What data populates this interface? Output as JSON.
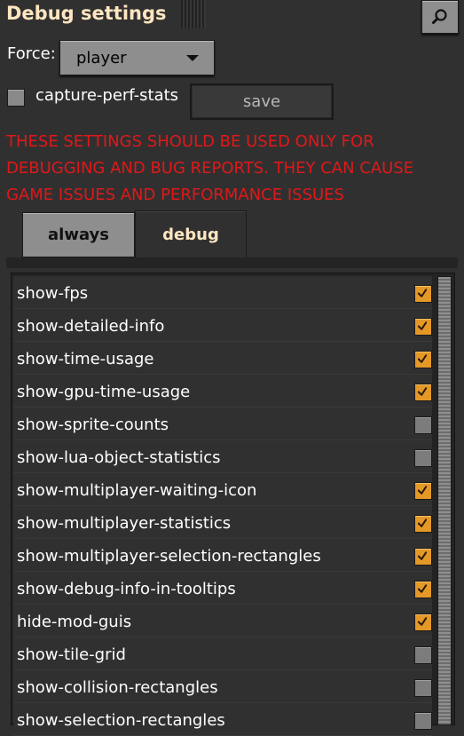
{
  "window": {
    "title": "Debug settings"
  },
  "force": {
    "label": "Force:",
    "selected": "player"
  },
  "capture": {
    "label": "capture-perf-stats",
    "checked": false,
    "save_label": "save"
  },
  "warning_text": "THESE SETTINGS SHOULD BE USED ONLY FOR DEBUGGING AND BUG REPORTS. THEY CAN CAUSE GAME ISSUES AND PERFORMANCE ISSUES",
  "tabs": [
    {
      "label": "always",
      "active": false
    },
    {
      "label": "debug",
      "active": true
    }
  ],
  "settings": [
    {
      "label": "show-fps",
      "checked": true
    },
    {
      "label": "show-detailed-info",
      "checked": true
    },
    {
      "label": "show-time-usage",
      "checked": true
    },
    {
      "label": "show-gpu-time-usage",
      "checked": true
    },
    {
      "label": "show-sprite-counts",
      "checked": false
    },
    {
      "label": "show-lua-object-statistics",
      "checked": false
    },
    {
      "label": "show-multiplayer-waiting-icon",
      "checked": true
    },
    {
      "label": "show-multiplayer-statistics",
      "checked": true
    },
    {
      "label": "show-multiplayer-selection-rectangles",
      "checked": true
    },
    {
      "label": "show-debug-info-in-tooltips",
      "checked": true
    },
    {
      "label": "hide-mod-guis",
      "checked": true
    },
    {
      "label": "show-tile-grid",
      "checked": false
    },
    {
      "label": "show-collision-rectangles",
      "checked": false
    },
    {
      "label": "show-selection-rectangles",
      "checked": false
    }
  ],
  "colors": {
    "title": "#ffe6c0",
    "warning": "#e01818",
    "checkbox_on": "#e39827",
    "checkbox_off": "#7c7c7c",
    "panel_bg": "#313031"
  },
  "icons": {
    "search": "search-icon",
    "dropdown": "chevron-down-icon",
    "check": "check-icon"
  }
}
